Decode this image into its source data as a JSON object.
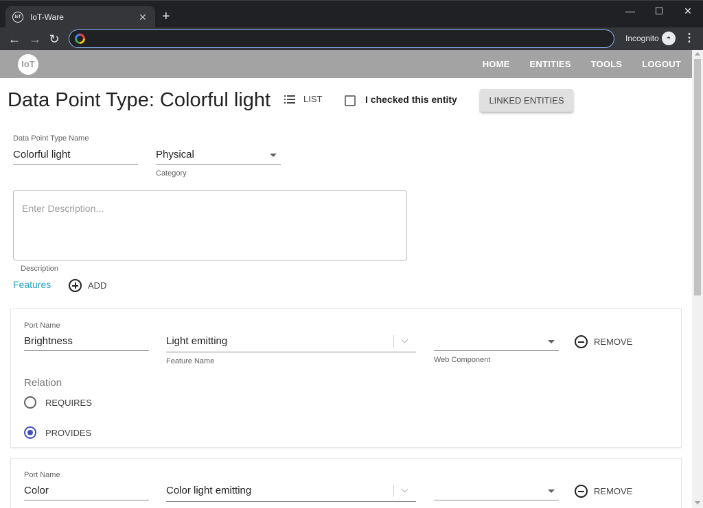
{
  "browser": {
    "tab_title": "IoT-Ware",
    "tab_favicon_text": "IoT",
    "tab_close": "✕",
    "new_tab": "+",
    "minimize": "—",
    "maximize": "☐",
    "close": "✕",
    "back": "←",
    "forward": "→",
    "reload": "↻",
    "incognito_label": "Incognito",
    "menu": "⋮"
  },
  "appbar": {
    "logo_text": "IoT",
    "nav": [
      "HOME",
      "ENTITIES",
      "TOOLS",
      "LOGOUT"
    ]
  },
  "header": {
    "title": "Data Point Type: Colorful light",
    "list_label": "LIST",
    "checkbox_label": "I checked this entity",
    "checkbox_checked": false,
    "linked_entities_label": "LINKED ENTITIES"
  },
  "form": {
    "name_label": "Data Point Type Name",
    "name_value": "Colorful light",
    "category_value": "Physical",
    "category_label": "Category",
    "description_placeholder": "Enter Description...",
    "description_label": "Description",
    "features_label": "Features",
    "add_label": "ADD"
  },
  "features": [
    {
      "port_name_label": "Port Name",
      "port_name": "Brightness",
      "feature_name": "Light emitting",
      "feature_name_label": "Feature Name",
      "web_component_value": "",
      "web_component_label": "Web Component",
      "remove_label": "REMOVE",
      "relation_label": "Relation",
      "options": [
        "REQUIRES",
        "PROVIDES"
      ],
      "selected": "PROVIDES"
    },
    {
      "port_name_label": "Port Name",
      "port_name": "Color",
      "feature_name": "Color light emitting",
      "remove_label": "REMOVE"
    }
  ]
}
